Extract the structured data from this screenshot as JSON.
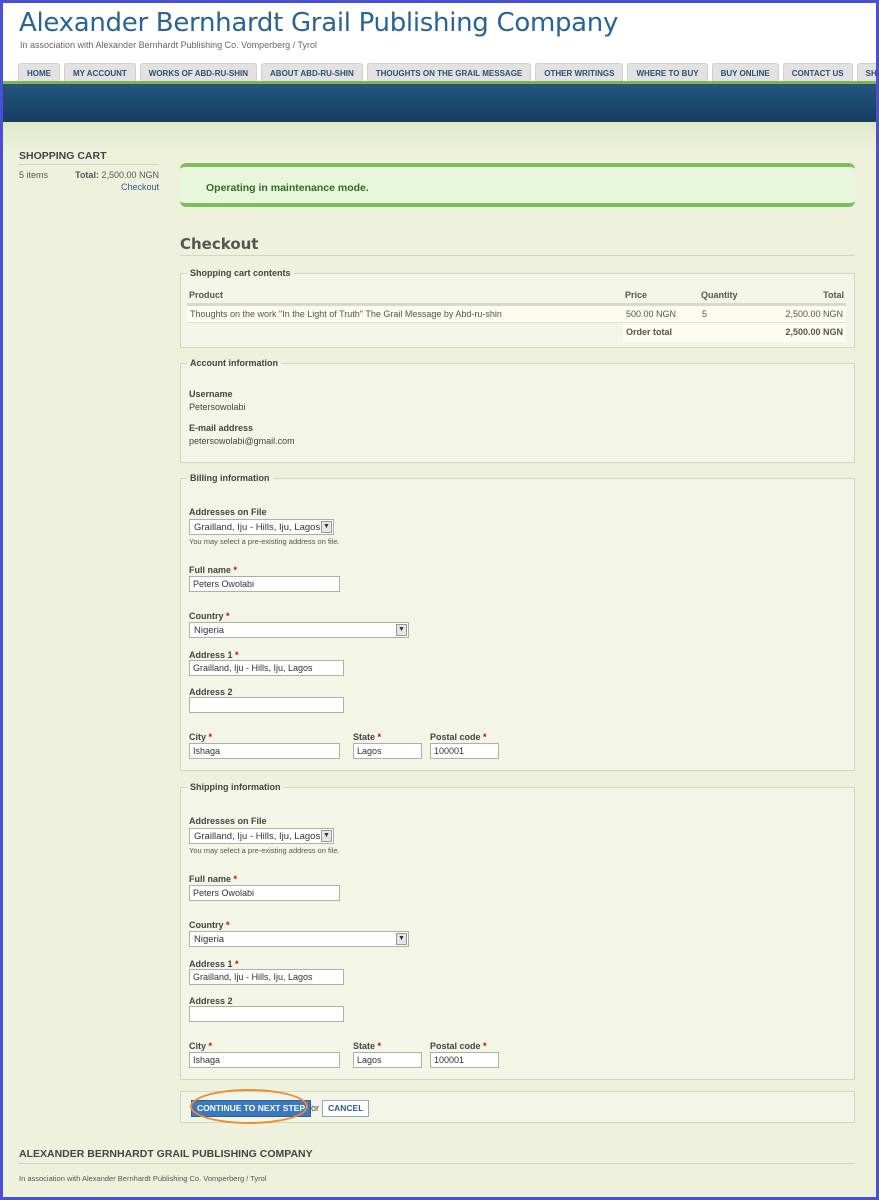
{
  "site": {
    "name": "Alexander Bernhardt Grail Publishing Company",
    "slogan": "In association with Alexander Bernhardt Publishing Co. Vomperberg / Tyrol"
  },
  "nav": [
    "HOME",
    "MY ACCOUNT",
    "WORKS OF ABD-RU-SHIN",
    "ABOUT ABD-RU-SHIN",
    "THOUGHTS ON THE GRAIL MESSAGE",
    "OTHER WRITINGS",
    "WHERE TO BUY",
    "BUY ONLINE",
    "CONTACT US",
    "SHIPPING"
  ],
  "sidebar": {
    "title": "SHOPPING CART",
    "items_count": "5 items",
    "total_label": "Total:",
    "total_value": "2,500.00 NGN",
    "checkout_link": "Checkout"
  },
  "message": "Operating in maintenance mode.",
  "page_title": "Checkout",
  "cart": {
    "legend": "Shopping cart contents",
    "headers": {
      "product": "Product",
      "price": "Price",
      "quantity": "Quantity",
      "total": "Total"
    },
    "rows": [
      {
        "product": "Thoughts on the work \"In the Light of Truth\" The Grail Message by Abd-ru-shin",
        "price": "500.00 NGN",
        "quantity": "5",
        "total": "2,500.00 NGN"
      }
    ],
    "order_total_label": "Order total",
    "order_total_value": "2,500.00 NGN"
  },
  "account": {
    "legend": "Account information",
    "username_label": "Username",
    "username": "Petersowolabi",
    "email_label": "E-mail address",
    "email": "petersowolabi@gmail.com"
  },
  "billing": {
    "legend": "Billing information",
    "addresses_label": "Addresses on File",
    "addresses_selected": "Grailland, Iju - Hills, Iju, Lagos",
    "addresses_help": "You may select a pre-existing address on file.",
    "fullname_label": "Full name",
    "fullname": "Peters Owolabi",
    "country_label": "Country",
    "country": "Nigeria",
    "address1_label": "Address 1",
    "address1": "Grailland, Iju - Hills, Iju, Lagos",
    "address2_label": "Address 2",
    "address2": "",
    "city_label": "City",
    "city": "Ishaga",
    "state_label": "State",
    "state": "Lagos",
    "postal_label": "Postal code",
    "postal": "100001",
    "required_mark": "*"
  },
  "shipping": {
    "legend": "Shipping information",
    "addresses_label": "Addresses on File",
    "addresses_selected": "Grailland, Iju - Hills, Iju, Lagos",
    "addresses_help": "You may select a pre-existing address on file.",
    "fullname_label": "Full name",
    "fullname": "Peters Owolabi",
    "country_label": "Country",
    "country": "Nigeria",
    "address1_label": "Address 1",
    "address1": "Grailland, Iju - Hills, Iju, Lagos",
    "address2_label": "Address 2",
    "address2": "",
    "city_label": "City",
    "city": "Ishaga",
    "state_label": "State",
    "state": "Lagos",
    "postal_label": "Postal code",
    "postal": "100001",
    "required_mark": "*"
  },
  "actions": {
    "continue_label": "CONTINUE TO NEXT STEP",
    "or_text": "or",
    "cancel_label": "CANCEL"
  },
  "footer": {
    "title": "ALEXANDER BERNHARDT GRAIL PUBLISHING COMPANY",
    "text": "In association with Alexander Bernhardt Publishing Co. Vomperberg / Tyrol"
  },
  "colors": {
    "brand": "#2a6494",
    "nav_accent": "#7ab851",
    "banner": "#1b4a70",
    "highlight": "#f08a2c"
  }
}
